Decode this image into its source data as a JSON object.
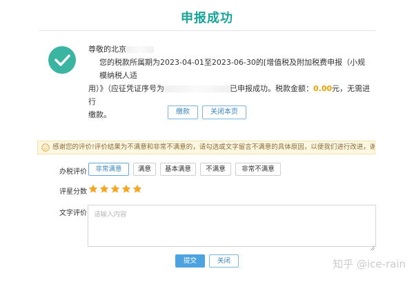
{
  "page": {
    "title": "申报成功"
  },
  "message": {
    "greeting": "尊敬的北京",
    "line1_prefix": "您的税款所属期为2023-04-01至2023-06-30的[增值税及附加税费申报（小规模纳税人适",
    "line2_prefix": "用）》（应征凭证序号为",
    "line2_suffix": "已申报成功。税款金额：",
    "amount": "0.00",
    "line2_tail": "元，无需进行",
    "line3": "缴款。"
  },
  "actions": {
    "pay_label": "缴款",
    "close_page_label": "关闭本页"
  },
  "notice": {
    "text": "感谢您的评价!评价结果为不满意和非常不满意的，请勾选或文字留言不满意的具体原因，以便我们进行改进，谢谢!"
  },
  "evaluation": {
    "rating_label": "办税评价",
    "options": [
      "非常满意",
      "满意",
      "基本满意",
      "不满意",
      "非常不满意"
    ],
    "selected_index": 0,
    "stars_label": "评星分数",
    "stars_value": 5,
    "stars_max": 5,
    "star_color": "#f5a623",
    "comment_label": "文字评价",
    "comment_placeholder": "请输入内容",
    "comment_value": ""
  },
  "footer": {
    "submit_label": "提交",
    "close_label": "关闭"
  },
  "watermark": {
    "text": "知乎 @ice-rain"
  },
  "colors": {
    "accent": "#1aa39a",
    "success": "#3bb5a1",
    "primary_button": "#4da3e0",
    "amount": "#e8a200"
  }
}
